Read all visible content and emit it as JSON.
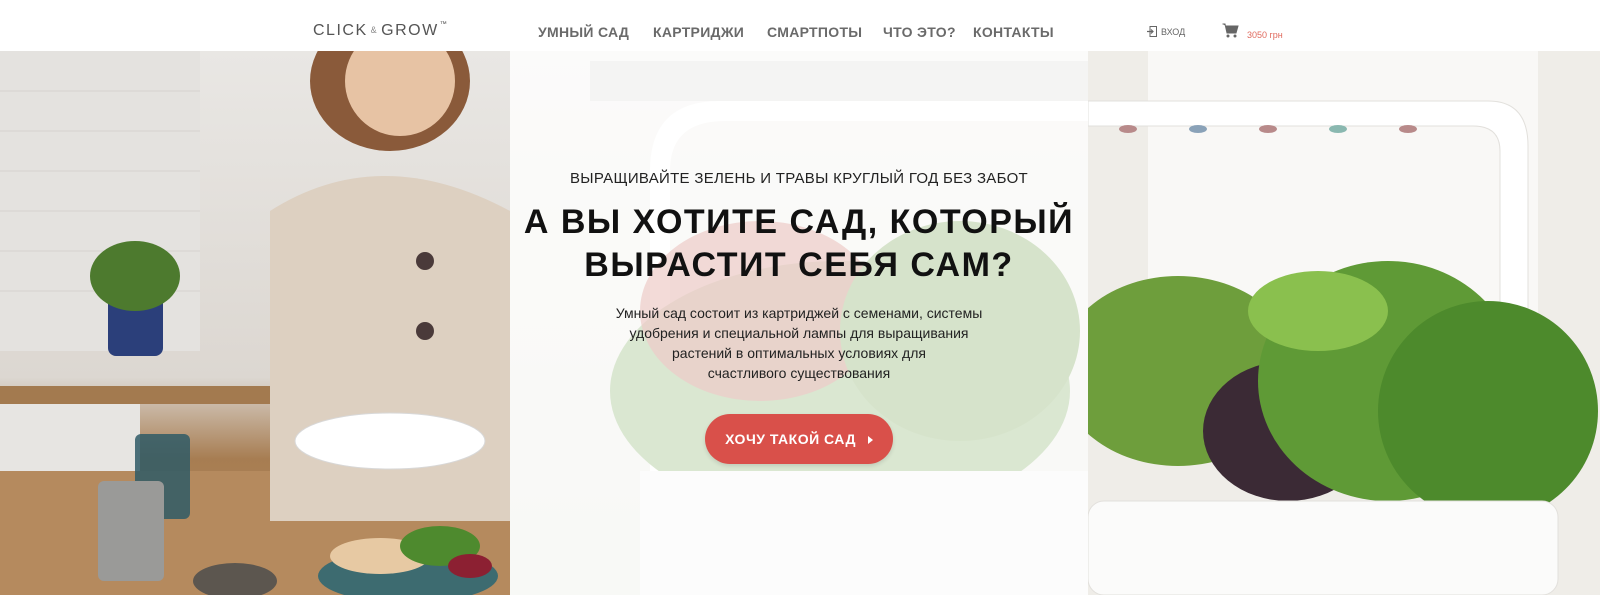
{
  "header": {
    "logo": {
      "left": "CLICK",
      "amp": "&",
      "right": "GROW",
      "tm": "™"
    },
    "nav": [
      {
        "label": "УМНЫЙ САД",
        "id": "smart-garden"
      },
      {
        "label": "КАРТРИДЖИ",
        "id": "cartridges"
      },
      {
        "label": "СМАРТПОТЫ",
        "id": "smartpots"
      },
      {
        "label": "ЧТО ЭТО?",
        "id": "what-is-it"
      },
      {
        "label": "КОНТАКТЫ",
        "id": "contacts"
      }
    ],
    "login_label": "ВХОД",
    "cart_total": "3050 грн"
  },
  "hero": {
    "subheading": "ВЫРАЩИВАЙТЕ ЗЕЛЕНЬ И ТРАВЫ КРУГЛЫЙ ГОД БЕЗ ЗАБОТ",
    "headline_line1": "А ВЫ ХОТИТЕ САД, КОТОРЫЙ",
    "headline_line2": "ВЫРАСТИТ СЕБЯ САМ?",
    "description_line1": "Умный сад состоит из картриджей с семенами, системы",
    "description_line2": "удобрения и специальной лампы для выращивания",
    "description_line3": "растений в оптимальных  условиях для",
    "description_line4": "счастливого существования",
    "cta_label": "ХОЧУ ТАКОЙ САД"
  },
  "colors": {
    "accent": "#d9504a",
    "cart_total": "#e06a5e",
    "nav_text": "#6a6a6a"
  }
}
